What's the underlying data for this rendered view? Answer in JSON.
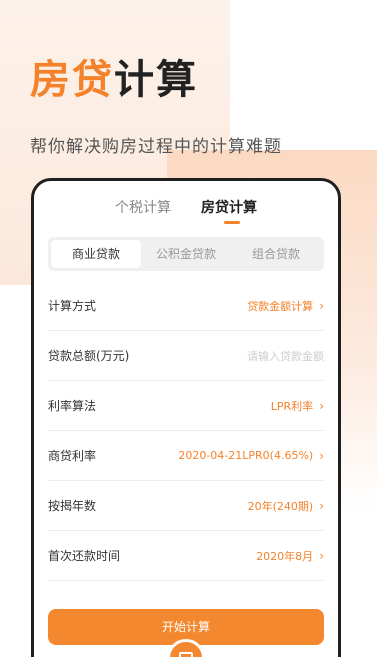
{
  "hero": {
    "title_accent": "房贷",
    "title_rest": "计算",
    "subtitle": "帮你解决购房过程中的计算难题"
  },
  "top_tabs": [
    {
      "label": "个税计算",
      "active": false
    },
    {
      "label": "房贷计算",
      "active": true
    }
  ],
  "loan_types": [
    {
      "label": "商业贷款",
      "active": true
    },
    {
      "label": "公积金贷款",
      "active": false
    },
    {
      "label": "组合贷款",
      "active": false
    }
  ],
  "rows": [
    {
      "label": "计算方式",
      "value": "贷款金额计算",
      "placeholder": false
    },
    {
      "label": "贷款总额(万元)",
      "value": "请输入贷款金额",
      "placeholder": true
    },
    {
      "label": "利率算法",
      "value": "LPR利率",
      "placeholder": false
    },
    {
      "label": "商贷利率",
      "value": "2020-04-21LPR0(4.65%)",
      "placeholder": false
    },
    {
      "label": "按揭年数",
      "value": "20年(240期)",
      "placeholder": false
    },
    {
      "label": "首次还款时间",
      "value": "2020年8月",
      "placeholder": false
    }
  ],
  "start_button": "开始计算",
  "colors": {
    "accent": "#f3822b",
    "text": "#333333",
    "muted": "#999999"
  },
  "icons": {
    "chevron": "chevron-right-icon",
    "calculator": "calculator-icon"
  }
}
